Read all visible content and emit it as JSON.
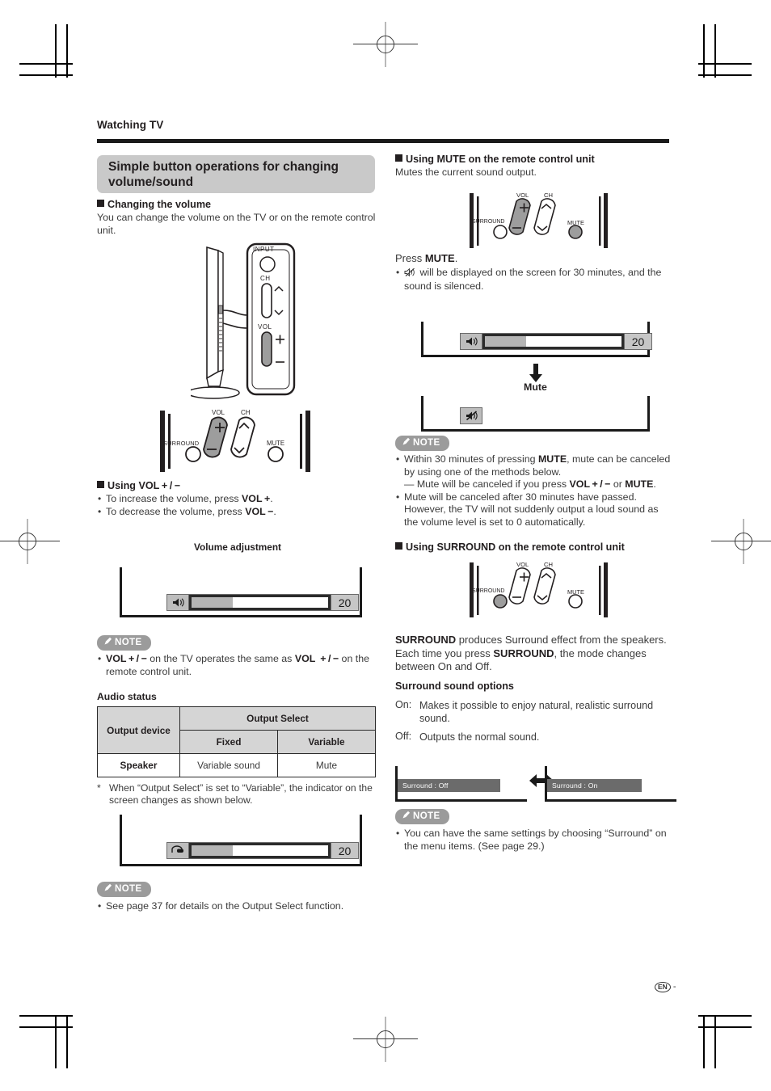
{
  "page": {
    "running_head": "Watching TV",
    "section_title": "Simple button operations for changing volume/sound",
    "folio_badge": "EN",
    "folio_dash": "-"
  },
  "left": {
    "changing_volume": {
      "heading": "Changing the volume",
      "body": "You can change the volume on the TV or on the remote control unit."
    },
    "tv_panel": {
      "input_label": "INPUT",
      "ch_label": "CH",
      "vol_label": "VOL",
      "plus": "+",
      "minus": "−"
    },
    "remote": {
      "vol_label": "VOL",
      "ch_label": "CH",
      "surround_label": "SURROUND",
      "mute_label": "MUTE",
      "plus": "+",
      "minus": "−"
    },
    "using_vol": {
      "heading": "Using VOL + / −",
      "bullet_increase_pre": "To increase the volume, press ",
      "bullet_increase_key": "VOL +",
      "bullet_increase_post": ".",
      "bullet_decrease_pre": "To decrease the volume, press ",
      "bullet_decrease_key": "VOL −",
      "bullet_decrease_post": "."
    },
    "volume_adjustment_caption": "Volume adjustment",
    "osd_volume": {
      "icon": "speaker-icon",
      "value": "20",
      "fill_percent": 30
    },
    "note_vol": {
      "badge": "NOTE",
      "text_pre": "",
      "key1": "VOL + / −",
      "text_mid": " on the TV operates the same as ",
      "key2": "VOL  + / −",
      "text_post": " on the remote control unit."
    },
    "audio_status": {
      "caption": "Audio status",
      "col_device": "Output device",
      "col_group": "Output Select",
      "col_fixed": "Fixed",
      "col_variable": "Variable",
      "rows": [
        {
          "device": "Speaker",
          "fixed": "Variable sound",
          "variable": "Mute"
        }
      ]
    },
    "footnote": {
      "star": "*",
      "text": "When “Output Select” is set to “Variable”, the indicator on the screen changes as shown below."
    },
    "osd_variable": {
      "icon": "headphone-icon",
      "value": "20",
      "fill_percent": 30
    },
    "note_output_select": {
      "badge": "NOTE",
      "text": "See page 37 for details on the Output Select function."
    }
  },
  "right": {
    "using_mute": {
      "heading": "Using MUTE on the remote control unit",
      "body": "Mutes the current sound output.",
      "press_pre": "Press ",
      "press_key": "MUTE",
      "press_post": ".",
      "bullet_post": " will be displayed on the screen for 30 minutes, and the sound is silenced."
    },
    "remote": {
      "vol_label": "VOL",
      "ch_label": "CH",
      "surround_label": "SURROUND",
      "mute_label": "MUTE",
      "plus": "+",
      "minus": "−"
    },
    "osd_before": {
      "icon": "speaker-icon",
      "value": "20",
      "fill_percent": 30
    },
    "mute_arrow_label": "Mute",
    "osd_after": {
      "icon": "speaker-mute-icon"
    },
    "note_mute": {
      "badge": "NOTE",
      "b1_pre": "Within 30 minutes of pressing ",
      "b1_key": "MUTE",
      "b1_post": ", mute can be canceled by using one of the methods below.",
      "b1_sub_pre": "— Mute will be canceled if you press ",
      "b1_sub_key1": "VOL + / −",
      "b1_sub_mid": " or ",
      "b1_sub_key2": "MUTE",
      "b1_sub_post": ".",
      "b2": "Mute will be canceled after 30 minutes have passed. However, the TV will not suddenly output a loud sound as the volume level is set to 0 automatically."
    },
    "using_surround": {
      "heading": "Using SURROUND on the remote control unit",
      "body_key1": "SURROUND",
      "body_mid1": " produces Surround effect from the speakers. Each time you press ",
      "body_key2": "SURROUND",
      "body_post": ", the mode changes between On and Off."
    },
    "surround_options": {
      "caption": "Surround sound options",
      "on_label": "On:",
      "on_text": "Makes it possible to enjoy natural, realistic surround sound.",
      "off_label": "Off:",
      "off_text": "Outputs the normal sound."
    },
    "surround_banners": {
      "off": "Surround : Off",
      "on": "Surround : On"
    },
    "note_surround": {
      "badge": "NOTE",
      "text": "You can have the same settings by choosing “Surround” on the menu items. (See page 29.)"
    }
  }
}
